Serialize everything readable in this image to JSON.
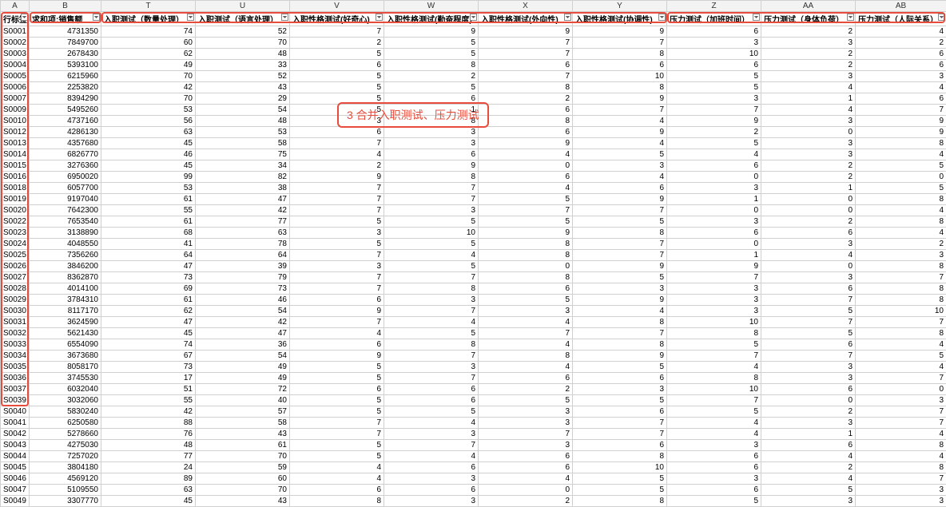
{
  "columns_letters": [
    "A",
    "B",
    "T",
    "U",
    "V",
    "W",
    "X",
    "Y",
    "Z",
    "AA",
    "AB"
  ],
  "headers": {
    "A": "行标签",
    "B": "求和项:销售额",
    "T": "入职测试（数量处理）",
    "U": "入职测试（语言处理）",
    "V": "入职性格测试(好奇心)",
    "W": "入职性格测试(勤奋程度)",
    "X": "入职性格测试(外向性)",
    "Y": "入职性格测试(协调性)",
    "Z": "压力测试（加班时间）",
    "AA": "压力测试（身体负荷）",
    "AB": "压力测试（人际关系）"
  },
  "annotation": "3 合并入职测试、压力测试",
  "rows": [
    {
      "A": "S0001",
      "B": 4731350,
      "T": 74,
      "U": 52,
      "V": 7,
      "W": 9,
      "X": 9,
      "Y": 9,
      "Z": 6,
      "AA": 2,
      "AB": 4
    },
    {
      "A": "S0002",
      "B": 7849700,
      "T": 60,
      "U": 70,
      "V": 2,
      "W": 5,
      "X": 7,
      "Y": 7,
      "Z": 3,
      "AA": 3,
      "AB": 2
    },
    {
      "A": "S0003",
      "B": 2678430,
      "T": 62,
      "U": 48,
      "V": 5,
      "W": 5,
      "X": 7,
      "Y": 8,
      "Z": 10,
      "AA": 2,
      "AB": 6
    },
    {
      "A": "S0004",
      "B": 5393100,
      "T": 49,
      "U": 33,
      "V": 6,
      "W": 8,
      "X": 6,
      "Y": 6,
      "Z": 6,
      "AA": 2,
      "AB": 6
    },
    {
      "A": "S0005",
      "B": 6215960,
      "T": 70,
      "U": 52,
      "V": 5,
      "W": 2,
      "X": 7,
      "Y": 10,
      "Z": 5,
      "AA": 3,
      "AB": 3
    },
    {
      "A": "S0006",
      "B": 2253820,
      "T": 42,
      "U": 43,
      "V": 5,
      "W": 5,
      "X": 8,
      "Y": 8,
      "Z": 5,
      "AA": 4,
      "AB": 4
    },
    {
      "A": "S0007",
      "B": 8394290,
      "T": 70,
      "U": 29,
      "V": 5,
      "W": 6,
      "X": 2,
      "Y": 9,
      "Z": 3,
      "AA": 1,
      "AB": 6
    },
    {
      "A": "S0009",
      "B": 5495260,
      "T": 53,
      "U": 54,
      "V": 5,
      "W": 1,
      "X": 6,
      "Y": 7,
      "Z": 7,
      "AA": 4,
      "AB": 7
    },
    {
      "A": "S0010",
      "B": 4737160,
      "T": 56,
      "U": 48,
      "V": 3,
      "W": 8,
      "X": 8,
      "Y": 4,
      "Z": 9,
      "AA": 3,
      "AB": 9
    },
    {
      "A": "S0012",
      "B": 4286130,
      "T": 63,
      "U": 53,
      "V": 6,
      "W": 3,
      "X": 6,
      "Y": 9,
      "Z": 2,
      "AA": 0,
      "AB": 9
    },
    {
      "A": "S0013",
      "B": 4357680,
      "T": 45,
      "U": 58,
      "V": 7,
      "W": 3,
      "X": 9,
      "Y": 4,
      "Z": 5,
      "AA": 3,
      "AB": 8
    },
    {
      "A": "S0014",
      "B": 6826770,
      "T": 46,
      "U": 75,
      "V": 4,
      "W": 6,
      "X": 4,
      "Y": 5,
      "Z": 4,
      "AA": 3,
      "AB": 4
    },
    {
      "A": "S0015",
      "B": 3276360,
      "T": 45,
      "U": 34,
      "V": 2,
      "W": 9,
      "X": 0,
      "Y": 3,
      "Z": 6,
      "AA": 2,
      "AB": 5
    },
    {
      "A": "S0016",
      "B": 6950020,
      "T": 99,
      "U": 82,
      "V": 9,
      "W": 8,
      "X": 6,
      "Y": 4,
      "Z": 0,
      "AA": 2,
      "AB": 0
    },
    {
      "A": "S0018",
      "B": 6057700,
      "T": 53,
      "U": 38,
      "V": 7,
      "W": 7,
      "X": 4,
      "Y": 6,
      "Z": 3,
      "AA": 1,
      "AB": 5
    },
    {
      "A": "S0019",
      "B": 9197040,
      "T": 61,
      "U": 47,
      "V": 7,
      "W": 7,
      "X": 5,
      "Y": 9,
      "Z": 1,
      "AA": 0,
      "AB": 8
    },
    {
      "A": "S0020",
      "B": 7642300,
      "T": 55,
      "U": 42,
      "V": 7,
      "W": 3,
      "X": 7,
      "Y": 7,
      "Z": 0,
      "AA": 0,
      "AB": 4
    },
    {
      "A": "S0022",
      "B": 7653540,
      "T": 61,
      "U": 77,
      "V": 5,
      "W": 5,
      "X": 5,
      "Y": 5,
      "Z": 3,
      "AA": 2,
      "AB": 8
    },
    {
      "A": "S0023",
      "B": 3138890,
      "T": 68,
      "U": 63,
      "V": 3,
      "W": 10,
      "X": 9,
      "Y": 8,
      "Z": 6,
      "AA": 6,
      "AB": 4
    },
    {
      "A": "S0024",
      "B": 4048550,
      "T": 41,
      "U": 78,
      "V": 5,
      "W": 5,
      "X": 8,
      "Y": 7,
      "Z": 0,
      "AA": 3,
      "AB": 2
    },
    {
      "A": "S0025",
      "B": 7356260,
      "T": 64,
      "U": 64,
      "V": 7,
      "W": 4,
      "X": 8,
      "Y": 7,
      "Z": 1,
      "AA": 4,
      "AB": 3
    },
    {
      "A": "S0026",
      "B": 3846200,
      "T": 47,
      "U": 39,
      "V": 3,
      "W": 5,
      "X": 0,
      "Y": 9,
      "Z": 9,
      "AA": 0,
      "AB": 8
    },
    {
      "A": "S0027",
      "B": 8362870,
      "T": 73,
      "U": 79,
      "V": 7,
      "W": 7,
      "X": 8,
      "Y": 5,
      "Z": 7,
      "AA": 3,
      "AB": 7
    },
    {
      "A": "S0028",
      "B": 4014100,
      "T": 69,
      "U": 73,
      "V": 7,
      "W": 8,
      "X": 6,
      "Y": 3,
      "Z": 3,
      "AA": 6,
      "AB": 8
    },
    {
      "A": "S0029",
      "B": 3784310,
      "T": 61,
      "U": 46,
      "V": 6,
      "W": 3,
      "X": 5,
      "Y": 9,
      "Z": 3,
      "AA": 7,
      "AB": 8
    },
    {
      "A": "S0030",
      "B": 8117170,
      "T": 62,
      "U": 54,
      "V": 9,
      "W": 7,
      "X": 3,
      "Y": 4,
      "Z": 3,
      "AA": 5,
      "AB": 10
    },
    {
      "A": "S0031",
      "B": 3624590,
      "T": 47,
      "U": 42,
      "V": 7,
      "W": 4,
      "X": 4,
      "Y": 8,
      "Z": 10,
      "AA": 7,
      "AB": 7
    },
    {
      "A": "S0032",
      "B": 5621430,
      "T": 45,
      "U": 47,
      "V": 4,
      "W": 5,
      "X": 7,
      "Y": 7,
      "Z": 8,
      "AA": 5,
      "AB": 8
    },
    {
      "A": "S0033",
      "B": 6554090,
      "T": 74,
      "U": 36,
      "V": 6,
      "W": 8,
      "X": 4,
      "Y": 8,
      "Z": 5,
      "AA": 6,
      "AB": 4
    },
    {
      "A": "S0034",
      "B": 3673680,
      "T": 67,
      "U": 54,
      "V": 9,
      "W": 7,
      "X": 8,
      "Y": 9,
      "Z": 7,
      "AA": 7,
      "AB": 5
    },
    {
      "A": "S0035",
      "B": 8058170,
      "T": 73,
      "U": 49,
      "V": 5,
      "W": 3,
      "X": 4,
      "Y": 5,
      "Z": 4,
      "AA": 3,
      "AB": 4
    },
    {
      "A": "S0036",
      "B": 3745530,
      "T": 17,
      "U": 49,
      "V": 5,
      "W": 7,
      "X": 6,
      "Y": 6,
      "Z": 8,
      "AA": 3,
      "AB": 7
    },
    {
      "A": "S0037",
      "B": 6032040,
      "T": 51,
      "U": 72,
      "V": 6,
      "W": 6,
      "X": 2,
      "Y": 3,
      "Z": 10,
      "AA": 6,
      "AB": 0
    },
    {
      "A": "S0039",
      "B": 3032060,
      "T": 55,
      "U": 40,
      "V": 5,
      "W": 6,
      "X": 5,
      "Y": 5,
      "Z": 7,
      "AA": 0,
      "AB": 3
    },
    {
      "A": "S0040",
      "B": 5830240,
      "T": 42,
      "U": 57,
      "V": 5,
      "W": 5,
      "X": 3,
      "Y": 6,
      "Z": 5,
      "AA": 2,
      "AB": 7
    },
    {
      "A": "S0041",
      "B": 6250580,
      "T": 88,
      "U": 58,
      "V": 7,
      "W": 4,
      "X": 3,
      "Y": 7,
      "Z": 4,
      "AA": 3,
      "AB": 7
    },
    {
      "A": "S0042",
      "B": 5278660,
      "T": 76,
      "U": 43,
      "V": 7,
      "W": 3,
      "X": 7,
      "Y": 7,
      "Z": 4,
      "AA": 1,
      "AB": 4
    },
    {
      "A": "S0043",
      "B": 4275030,
      "T": 48,
      "U": 61,
      "V": 5,
      "W": 7,
      "X": 3,
      "Y": 6,
      "Z": 3,
      "AA": 6,
      "AB": 8
    },
    {
      "A": "S0044",
      "B": 7257020,
      "T": 77,
      "U": 70,
      "V": 5,
      "W": 4,
      "X": 6,
      "Y": 8,
      "Z": 6,
      "AA": 4,
      "AB": 4
    },
    {
      "A": "S0045",
      "B": 3804180,
      "T": 24,
      "U": 59,
      "V": 4,
      "W": 6,
      "X": 6,
      "Y": 10,
      "Z": 6,
      "AA": 2,
      "AB": 8
    },
    {
      "A": "S0046",
      "B": 4569120,
      "T": 89,
      "U": 60,
      "V": 4,
      "W": 3,
      "X": 4,
      "Y": 5,
      "Z": 3,
      "AA": 4,
      "AB": 7
    },
    {
      "A": "S0047",
      "B": 5109550,
      "T": 63,
      "U": 70,
      "V": 6,
      "W": 6,
      "X": 0,
      "Y": 5,
      "Z": 6,
      "AA": 5,
      "AB": 3
    },
    {
      "A": "S0049",
      "B": 3307770,
      "T": 45,
      "U": 43,
      "V": 8,
      "W": 3,
      "X": 2,
      "Y": 8,
      "Z": 5,
      "AA": 3,
      "AB": 3
    }
  ]
}
